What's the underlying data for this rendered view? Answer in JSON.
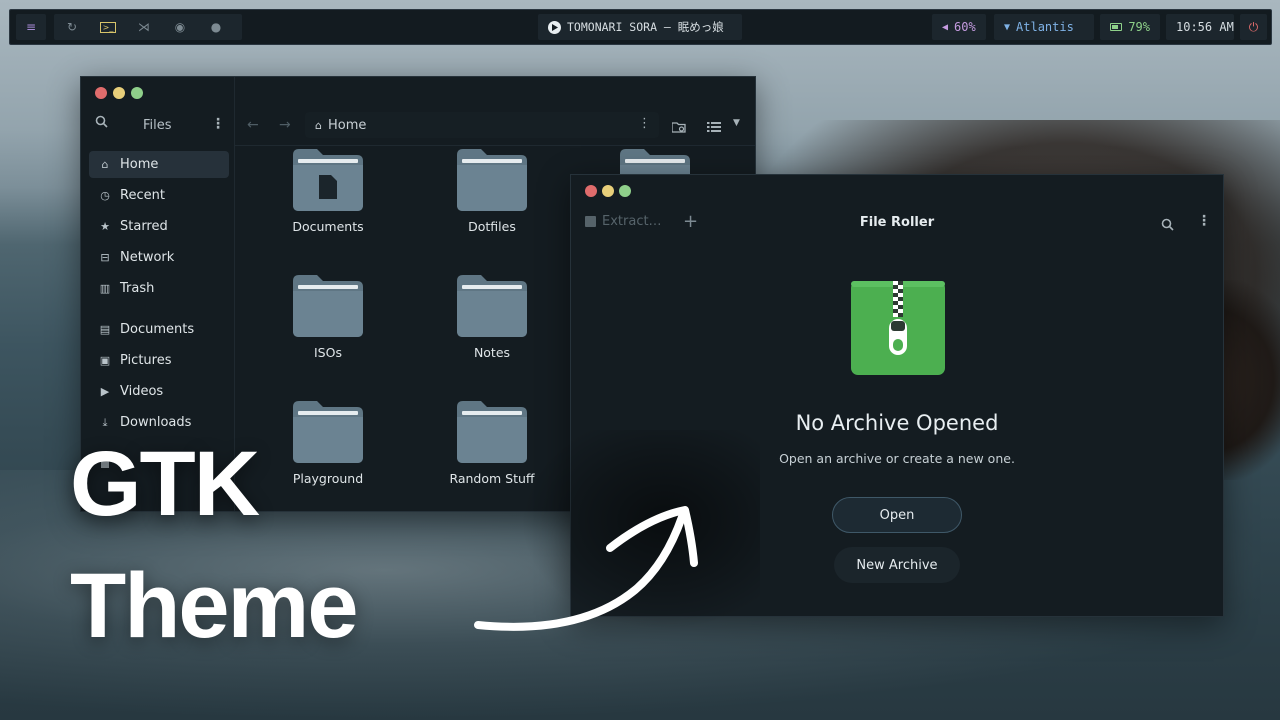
{
  "topbar": {
    "media": {
      "track": "TOMONARI SORA — 眠めっ娘"
    },
    "volume": "60%",
    "wifi": "Atlantis",
    "battery": "79%",
    "clock": "10:56 AM",
    "icons": [
      "menu-icon",
      "refresh-icon",
      "terminal-icon",
      "vscode-icon",
      "discord-icon",
      "spotify-icon"
    ]
  },
  "files": {
    "title": "Files",
    "location": "Home",
    "sidebar": [
      {
        "label": "Home",
        "icon": "home-icon",
        "active": true
      },
      {
        "label": "Recent",
        "icon": "clock-icon"
      },
      {
        "label": "Starred",
        "icon": "star-icon"
      },
      {
        "label": "Network",
        "icon": "network-icon"
      },
      {
        "label": "Trash",
        "icon": "trash-icon"
      },
      {
        "label": "Documents",
        "icon": "document-icon"
      },
      {
        "label": "Pictures",
        "icon": "picture-icon"
      },
      {
        "label": "Videos",
        "icon": "video-icon"
      },
      {
        "label": "Downloads",
        "icon": "download-icon"
      }
    ],
    "folders": [
      "Documents",
      "Dotfiles",
      "ISOs",
      "Notes",
      "Playground",
      "Random Stuff"
    ]
  },
  "roller": {
    "title": "File Roller",
    "extract_label": "Extract…",
    "empty_title": "No Archive Opened",
    "empty_subtitle": "Open an archive or create a new one.",
    "open_label": "Open",
    "new_label": "New Archive"
  },
  "overlay": {
    "line1": "GTK",
    "line2": "Theme"
  },
  "colors": {
    "accent_green": "#4caf50",
    "folder": "#5f7684",
    "bg_dark": "#141c21"
  }
}
